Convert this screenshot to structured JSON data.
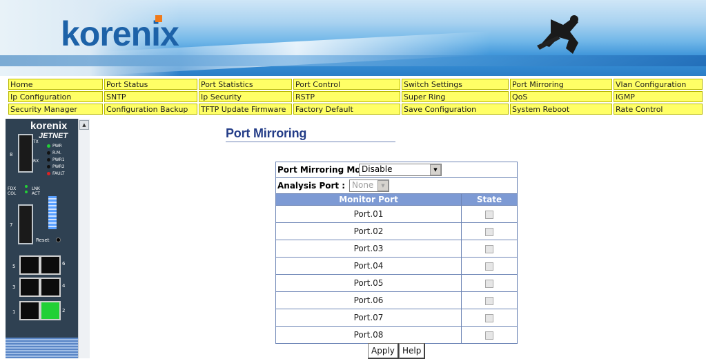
{
  "brand": {
    "logo_text": "korenix"
  },
  "menu": [
    [
      "Home",
      "Port Status",
      "Port Statistics",
      "Port Control",
      "Switch Settings",
      "Port Mirroring",
      "Vlan Configuration"
    ],
    [
      "Ip Configuration",
      "SNTP",
      "Ip Security",
      "RSTP",
      "Super Ring",
      "QoS",
      "IGMP"
    ],
    [
      "Security Manager",
      "Configuration Backup",
      "TFTP Update Firmware",
      "Factory Default",
      "Save Configuration",
      "System Reboot",
      "Rate Control"
    ]
  ],
  "device": {
    "brand": "korenix",
    "model": "JETNET",
    "leds": [
      "PWR",
      "R.M.",
      "PWR1",
      "PWR2",
      "FAULT"
    ],
    "fdx_label": "FDX COL",
    "lnk_label": "LNK ACT",
    "reset_label": "Reset",
    "port_numbers": [
      "8",
      "7",
      "5",
      "6",
      "3",
      "4",
      "1",
      "2"
    ],
    "tx_label": "TX",
    "rx_label": "RX"
  },
  "page": {
    "title": "Port Mirroring",
    "mode_label": "Port Mirroring Mode :",
    "mode_value": "Disable",
    "analysis_label": "Analysis Port :",
    "analysis_value": "None",
    "col_monitor": "Monitor Port",
    "col_state": "State",
    "ports": [
      "Port.01",
      "Port.02",
      "Port.03",
      "Port.04",
      "Port.05",
      "Port.06",
      "Port.07",
      "Port.08"
    ],
    "apply_label": "Apply",
    "help_label": "Help"
  },
  "colors": {
    "menu_bg": "#ffff66",
    "title": "#233c87",
    "header_bg": "#7d9ad4",
    "border": "#6c84b5"
  }
}
